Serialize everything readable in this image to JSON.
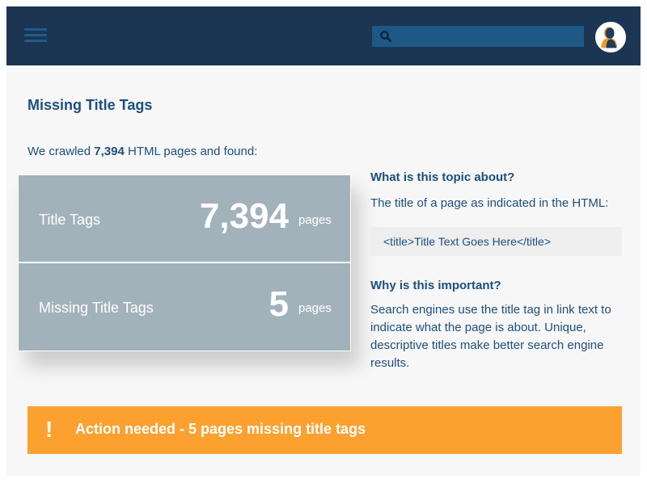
{
  "header": {
    "search": {
      "placeholder": "",
      "value": ""
    },
    "colors": {
      "bar": "#1b3552",
      "search": "#1d5887"
    }
  },
  "page": {
    "title": "Missing Title Tags",
    "crawl_prefix": "We crawled ",
    "crawl_count": "7,394",
    "crawl_suffix": " HTML pages and found:"
  },
  "stats": [
    {
      "label": "Title Tags",
      "value": "7,394",
      "unit": "pages"
    },
    {
      "label": "Missing Title Tags",
      "value": "5",
      "unit": "pages"
    }
  ],
  "info": {
    "q1": "What is this topic about?",
    "a1": "The title of a page as indicated in the HTML:",
    "code": "<title>Title Text Goes Here</title>",
    "q2": "Why is this important?",
    "a2": "Search engines use the title tag in link text to indicate what the page is about. Unique, descriptive titles make better search engine results."
  },
  "alert": {
    "icon": "!",
    "text": "Action needed - 5 pages missing title tags",
    "color": "#fca12f"
  },
  "icons": {
    "menu": "hamburger-menu-icon",
    "search": "search-icon",
    "avatar": "user-avatar-icon",
    "alert": "exclamation-icon"
  }
}
